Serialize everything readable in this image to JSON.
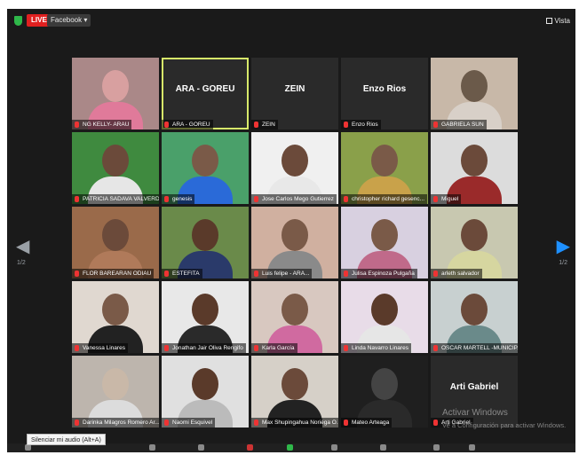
{
  "topbar": {
    "live_label": "LIVE",
    "platform_label": "Facebook ▾",
    "view_label": "Vista",
    "colors": {
      "live": "#e02020",
      "shield": "#2fb84a"
    }
  },
  "navigation": {
    "prev_arrow": "◀",
    "next_arrow": "▶",
    "page_left": "1/2",
    "page_right": "1/2"
  },
  "participants": [
    {
      "name": "NG KELLY- ARAU",
      "big": ""
    },
    {
      "name": "ARA - GOREU",
      "big": "ARA - GOREU",
      "active": true
    },
    {
      "name": "ZEIN",
      "big": "ZEIN"
    },
    {
      "name": "Enzo Rios",
      "big": "Enzo Rios"
    },
    {
      "name": "GABRIELA SUN",
      "big": ""
    },
    {
      "name": "PATRICIA SADAVA VALVERDE",
      "big": ""
    },
    {
      "name": "genesis",
      "big": ""
    },
    {
      "name": "Jose Carlos Mego Gutierrez",
      "big": ""
    },
    {
      "name": "christopher richard gesenc...",
      "big": ""
    },
    {
      "name": "Miguel",
      "big": ""
    },
    {
      "name": "FLOR BAREARAN ODIAU",
      "big": ""
    },
    {
      "name": "ESTEFITA",
      "big": ""
    },
    {
      "name": "Luis felipe - ARA...",
      "big": ""
    },
    {
      "name": "Julisa Espinoza Pulgaña",
      "big": ""
    },
    {
      "name": "arleth salvador",
      "big": ""
    },
    {
      "name": "Vanessa Linares",
      "big": ""
    },
    {
      "name": "Jonathan Jair Oliva Rengifo",
      "big": ""
    },
    {
      "name": "Karla García",
      "big": ""
    },
    {
      "name": "Linda Navarro Linares",
      "big": ""
    },
    {
      "name": "OSCAR MARTELL -MUNICIPAL...",
      "big": ""
    },
    {
      "name": "Darinka Milagros Romero Ar...",
      "big": ""
    },
    {
      "name": "Naomi Esquivel",
      "big": ""
    },
    {
      "name": "Max Shupingahua Noriega O...",
      "big": ""
    },
    {
      "name": "Mateo Arteaga",
      "big": ""
    },
    {
      "name": "Arti Gabriel",
      "big": "Arti Gabriel"
    }
  ],
  "watermark": {
    "title": "Activar Windows",
    "subtitle": "Ve a Configuración para activar Windows."
  },
  "tooltip": "Silenciar mi audio (Alt+A)"
}
